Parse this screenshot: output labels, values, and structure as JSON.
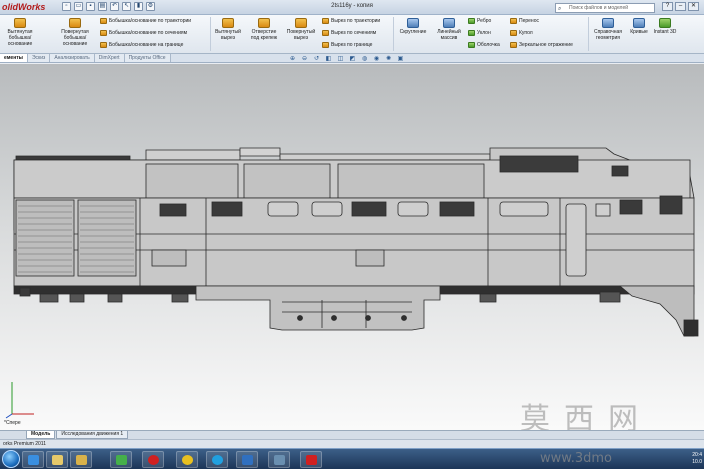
{
  "titlebar": {
    "logo": "olidWorks",
    "document_title": "2ts116y - копия",
    "search_placeholder": "Поиск файлов и моделей",
    "qat": [
      "new-icon",
      "open-icon",
      "save-icon",
      "print-icon",
      "undo-icon",
      "select-icon",
      "rebuild-icon",
      "options-icon"
    ]
  },
  "ribbon": {
    "extrude_boss": "Вытянутая бобышка/основание",
    "revolve_boss": "Повернутая бобышка/основание",
    "sweep_boss": "Бобышка/основание по траектории",
    "loft_boss": "Бобышка/основание по сечениям",
    "boundary_boss": "Бобышка/основание на границе",
    "extrude_cut": "Вытянутый вырез",
    "hole_wizard": "Отверстие под крепеж",
    "revolve_cut": "Повернутый вырез",
    "sweep_cut": "Вырез по траектории",
    "loft_cut": "Вырез по сечениям",
    "boundary_cut": "Вырез по границе",
    "fillet": "Скругление",
    "linear_pattern": "Линейный массив",
    "rib": "Ребро",
    "draft": "Уклон",
    "shell": "Оболочка",
    "wrap": "Перенос",
    "dome": "Купол",
    "mirror": "Зеркальное отражение",
    "ref_geometry": "Справочная геометрия",
    "curves": "Кривые",
    "instant3d": "Instant 3D"
  },
  "tabs": [
    {
      "label": "ементы",
      "active": true
    },
    {
      "label": "Эскиз",
      "active": false
    },
    {
      "label": "Анализировать",
      "active": false
    },
    {
      "label": "DimXpert",
      "active": false
    },
    {
      "label": "Продукты Office",
      "active": false
    }
  ],
  "viewport": {
    "triad_label": "*Спере",
    "colors": {
      "body": "#c9c9c9",
      "dark": "#3a3a3a",
      "line": "#2b2b2b"
    }
  },
  "model_tabs": [
    {
      "label": "Модель",
      "active": true
    },
    {
      "label": "Исследования движения 1",
      "active": false
    }
  ],
  "status": {
    "text": "orks Premium 2011"
  },
  "taskbar": {
    "apps": [
      "ie-icon",
      "explorer-icon",
      "folder-icon",
      "media-icon",
      "opera-icon",
      "chrome-icon",
      "skype-icon",
      "windows-icon",
      "photo-icon",
      "solidworks-icon"
    ],
    "time": "20:4",
    "date": "10.0"
  },
  "watermark": {
    "chars": "莫西网",
    "url": "www.3dmo"
  }
}
